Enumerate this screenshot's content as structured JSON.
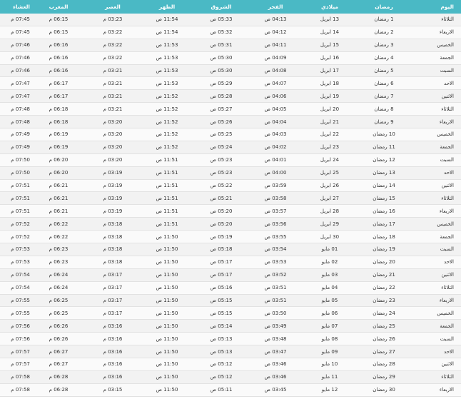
{
  "header": {
    "day": "اليوم",
    "ramadan": "رمضان",
    "gregorian": "ميلادي",
    "fajr": "الفجر",
    "sunrise": "الشروق",
    "dhuhr": "الظهر",
    "asr": "العصر",
    "maghrib": "المغرب",
    "isha": "العشاء"
  },
  "rows": [
    {
      "day": "الثلاثاء",
      "ramadan": "1 رمضان",
      "gregorian": "13 ابريل",
      "fajr": "04:13 ص",
      "sunrise": "05:33 ص",
      "dhuhr": "11:54 ص",
      "asr": "03:23 م",
      "maghrib": "06:15 م",
      "isha": "07:45 م"
    },
    {
      "day": "الاربعاء",
      "ramadan": "2 رمضان",
      "gregorian": "14 ابريل",
      "fajr": "04:12 ص",
      "sunrise": "05:32 ص",
      "dhuhr": "11:54 ص",
      "asr": "03:22 م",
      "maghrib": "06:15 م",
      "isha": "07:45 م"
    },
    {
      "day": "الخميس",
      "ramadan": "3 رمضان",
      "gregorian": "15 ابريل",
      "fajr": "04:11 ص",
      "sunrise": "05:31 ص",
      "dhuhr": "11:53 ص",
      "asr": "03:22 م",
      "maghrib": "06:16 م",
      "isha": "07:46 م"
    },
    {
      "day": "الجمعة",
      "ramadan": "4 رمضان",
      "gregorian": "16 ابريل",
      "fajr": "04:09 ص",
      "sunrise": "05:30 ص",
      "dhuhr": "11:53 ص",
      "asr": "03:22 م",
      "maghrib": "06:16 م",
      "isha": "07:46 م"
    },
    {
      "day": "السبت",
      "ramadan": "5 رمضان",
      "gregorian": "17 ابريل",
      "fajr": "04:08 ص",
      "sunrise": "05:30 ص",
      "dhuhr": "11:53 ص",
      "asr": "03:21 م",
      "maghrib": "06:16 م",
      "isha": "07:46 م"
    },
    {
      "day": "الاحد",
      "ramadan": "6 رمضان",
      "gregorian": "18 ابريل",
      "fajr": "04:07 ص",
      "sunrise": "05:29 ص",
      "dhuhr": "11:53 ص",
      "asr": "03:21 م",
      "maghrib": "06:17 م",
      "isha": "07:47 م"
    },
    {
      "day": "الاثنين",
      "ramadan": "7 رمضان",
      "gregorian": "19 ابريل",
      "fajr": "04:06 ص",
      "sunrise": "05:28 ص",
      "dhuhr": "11:52 ص",
      "asr": "03:21 م",
      "maghrib": "06:17 م",
      "isha": "07:47 م"
    },
    {
      "day": "الثلاثاء",
      "ramadan": "8 رمضان",
      "gregorian": "20 ابريل",
      "fajr": "04:05 ص",
      "sunrise": "05:27 ص",
      "dhuhr": "11:52 ص",
      "asr": "03:21 م",
      "maghrib": "06:18 م",
      "isha": "07:48 م"
    },
    {
      "day": "الاربعاء",
      "ramadan": "9 رمضان",
      "gregorian": "21 ابريل",
      "fajr": "04:04 ص",
      "sunrise": "05:26 ص",
      "dhuhr": "11:52 ص",
      "asr": "03:20 م",
      "maghrib": "06:18 م",
      "isha": "07:48 م"
    },
    {
      "day": "الخميس",
      "ramadan": "10 رمضان",
      "gregorian": "22 ابريل",
      "fajr": "04:03 ص",
      "sunrise": "05:25 ص",
      "dhuhr": "11:52 ص",
      "asr": "03:20 م",
      "maghrib": "06:19 م",
      "isha": "07:49 م"
    },
    {
      "day": "الجمعة",
      "ramadan": "11 رمضان",
      "gregorian": "23 ابريل",
      "fajr": "04:02 ص",
      "sunrise": "05:24 ص",
      "dhuhr": "11:52 ص",
      "asr": "03:20 م",
      "maghrib": "06:19 م",
      "isha": "07:49 م"
    },
    {
      "day": "السبت",
      "ramadan": "12 رمضان",
      "gregorian": "24 ابريل",
      "fajr": "04:01 ص",
      "sunrise": "05:23 ص",
      "dhuhr": "11:51 ص",
      "asr": "03:20 م",
      "maghrib": "06:20 م",
      "isha": "07:50 م"
    },
    {
      "day": "الاحد",
      "ramadan": "13 رمضان",
      "gregorian": "25 ابريل",
      "fajr": "04:00 ص",
      "sunrise": "05:23 ص",
      "dhuhr": "11:51 ص",
      "asr": "03:19 م",
      "maghrib": "06:20 م",
      "isha": "07:50 م"
    },
    {
      "day": "الاثنين",
      "ramadan": "14 رمضان",
      "gregorian": "26 ابريل",
      "fajr": "03:59 ص",
      "sunrise": "05:22 ص",
      "dhuhr": "11:51 ص",
      "asr": "03:19 م",
      "maghrib": "06:21 م",
      "isha": "07:51 م"
    },
    {
      "day": "الثلاثاء",
      "ramadan": "15 رمضان",
      "gregorian": "27 ابريل",
      "fajr": "03:58 ص",
      "sunrise": "05:21 ص",
      "dhuhr": "11:51 ص",
      "asr": "03:19 م",
      "maghrib": "06:21 م",
      "isha": "07:51 م"
    },
    {
      "day": "الاربعاء",
      "ramadan": "16 رمضان",
      "gregorian": "28 ابريل",
      "fajr": "03:57 ص",
      "sunrise": "05:20 ص",
      "dhuhr": "11:51 ص",
      "asr": "03:19 م",
      "maghrib": "06:21 م",
      "isha": "07:51 م"
    },
    {
      "day": "الخميس",
      "ramadan": "17 رمضان",
      "gregorian": "29 ابريل",
      "fajr": "03:56 ص",
      "sunrise": "05:20 ص",
      "dhuhr": "11:51 ص",
      "asr": "03:18 م",
      "maghrib": "06:22 م",
      "isha": "07:52 م"
    },
    {
      "day": "الجمعة",
      "ramadan": "18 رمضان",
      "gregorian": "30 ابريل",
      "fajr": "03:55 ص",
      "sunrise": "05:19 ص",
      "dhuhr": "11:50 ص",
      "asr": "03:18 م",
      "maghrib": "06:22 م",
      "isha": "07:52 م"
    },
    {
      "day": "السبت",
      "ramadan": "19 رمضان",
      "gregorian": "01 مايو",
      "fajr": "03:54 ص",
      "sunrise": "05:18 ص",
      "dhuhr": "11:50 ص",
      "asr": "03:18 م",
      "maghrib": "06:23 م",
      "isha": "07:53 م"
    },
    {
      "day": "الاحد",
      "ramadan": "20 رمضان",
      "gregorian": "02 مايو",
      "fajr": "03:53 ص",
      "sunrise": "05:17 ص",
      "dhuhr": "11:50 ص",
      "asr": "03:18 م",
      "maghrib": "06:23 م",
      "isha": "07:53 م"
    },
    {
      "day": "الاثنين",
      "ramadan": "21 رمضان",
      "gregorian": "03 مايو",
      "fajr": "03:52 ص",
      "sunrise": "05:17 ص",
      "dhuhr": "11:50 ص",
      "asr": "03:17 م",
      "maghrib": "06:24 م",
      "isha": "07:54 م"
    },
    {
      "day": "الثلاثاء",
      "ramadan": "22 رمضان",
      "gregorian": "04 مايو",
      "fajr": "03:51 ص",
      "sunrise": "05:16 ص",
      "dhuhr": "11:50 ص",
      "asr": "03:17 م",
      "maghrib": "06:24 م",
      "isha": "07:54 م"
    },
    {
      "day": "الاربعاء",
      "ramadan": "23 رمضان",
      "gregorian": "05 مايو",
      "fajr": "03:51 ص",
      "sunrise": "05:15 ص",
      "dhuhr": "11:50 ص",
      "asr": "03:17 م",
      "maghrib": "06:25 م",
      "isha": "07:55 م"
    },
    {
      "day": "الخميس",
      "ramadan": "24 رمضان",
      "gregorian": "06 مايو",
      "fajr": "03:50 ص",
      "sunrise": "05:15 ص",
      "dhuhr": "11:50 ص",
      "asr": "03:17 م",
      "maghrib": "06:25 م",
      "isha": "07:55 م"
    },
    {
      "day": "الجمعة",
      "ramadan": "25 رمضان",
      "gregorian": "07 مايو",
      "fajr": "03:49 ص",
      "sunrise": "05:14 ص",
      "dhuhr": "11:50 ص",
      "asr": "03:16 م",
      "maghrib": "06:26 م",
      "isha": "07:56 م"
    },
    {
      "day": "السبت",
      "ramadan": "26 رمضان",
      "gregorian": "08 مايو",
      "fajr": "03:48 ص",
      "sunrise": "05:13 ص",
      "dhuhr": "11:50 ص",
      "asr": "03:16 م",
      "maghrib": "06:26 م",
      "isha": "07:56 م"
    },
    {
      "day": "الاحد",
      "ramadan": "27 رمضان",
      "gregorian": "09 مايو",
      "fajr": "03:47 ص",
      "sunrise": "05:13 ص",
      "dhuhr": "11:50 ص",
      "asr": "03:16 م",
      "maghrib": "06:27 م",
      "isha": "07:57 م"
    },
    {
      "day": "الاثنين",
      "ramadan": "28 رمضان",
      "gregorian": "10 مايو",
      "fajr": "03:46 ص",
      "sunrise": "05:12 ص",
      "dhuhr": "11:50 ص",
      "asr": "03:16 م",
      "maghrib": "06:27 م",
      "isha": "07:57 م"
    },
    {
      "day": "الثلاثاء",
      "ramadan": "29 رمضان",
      "gregorian": "11 مايو",
      "fajr": "03:46 ص",
      "sunrise": "05:12 ص",
      "dhuhr": "11:50 ص",
      "asr": "03:16 م",
      "maghrib": "06:28 م",
      "isha": "07:58 م"
    },
    {
      "day": "الاربعاء",
      "ramadan": "30 رمضان",
      "gregorian": "12 مايو",
      "fajr": "03:45 ص",
      "sunrise": "05:11 ص",
      "dhuhr": "11:50 ص",
      "asr": "03:15 م",
      "maghrib": "06:28 م",
      "isha": "07:58 م"
    }
  ],
  "colors": {
    "header_bg": "#4ab9c5",
    "row_odd": "#f2f2f2",
    "row_even": "#fafafa",
    "border": "#e2e2e2"
  }
}
